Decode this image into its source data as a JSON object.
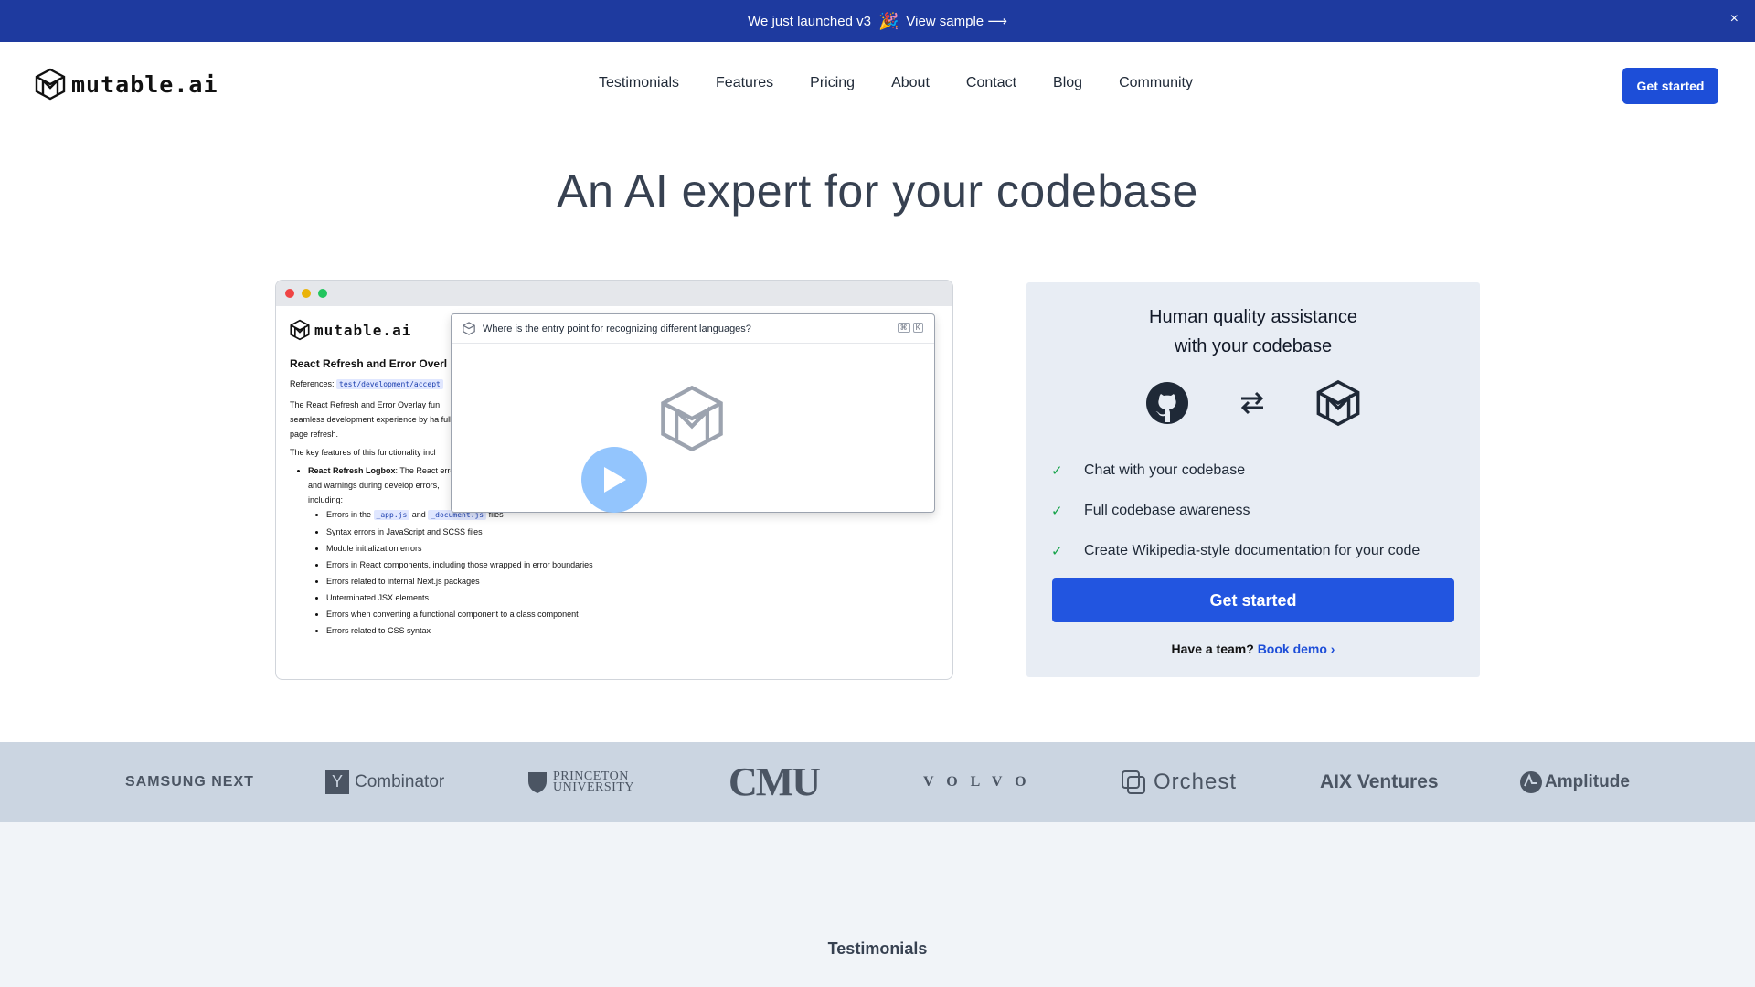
{
  "announcement": {
    "text": "We just launched v3",
    "emoji": "🎉",
    "link": "View sample ⟶",
    "close": "×"
  },
  "header": {
    "brand": "mutable.ai",
    "nav": [
      "Testimonials",
      "Features",
      "Pricing",
      "About",
      "Contact",
      "Blog",
      "Community"
    ],
    "cta": "Get started"
  },
  "hero": {
    "title": "An AI expert for your codebase"
  },
  "demo": {
    "brand": "mutable.ai",
    "doc_title": "React Refresh and Error Overl",
    "refs_label": "References:",
    "refs_code": "test/development/accept",
    "para1": "The React Refresh and Error Overlay fun seamless development experience by ha full page refresh.",
    "para2": "The key features of this functionality incl",
    "bullet_title": "React Refresh Logbox",
    "bullet_text": ": The React errors and warnings during develop errors, including:",
    "sub_items": [
      "Syntax errors in JavaScript and SCSS files",
      "Module initialization errors",
      "Errors in React components, including those wrapped in error boundaries",
      "Errors related to internal Next.js packages",
      "Unterminated JSX elements",
      "Errors when converting a functional component to a class component",
      "Errors related to CSS syntax"
    ],
    "first_item_pre": "Errors in the",
    "first_item_code1": "_app.js",
    "first_item_mid": "and",
    "first_item_code2": "_document.js",
    "first_item_post": "files",
    "popup_question": "Where is the entry point for recognizing different languages?",
    "popup_keys": [
      "⌘",
      "K"
    ]
  },
  "card": {
    "title_line1": "Human quality assistance",
    "title_line2": "with your codebase",
    "features": [
      "Chat with your codebase",
      "Full codebase awareness",
      "Create Wikipedia-style documentation for your code"
    ],
    "cta": "Get started",
    "team_text": "Have a team?",
    "team_link": "Book demo ›"
  },
  "logos": {
    "samsung": "SAMSUNG NEXT",
    "yc_box": "Y",
    "yc": "Combinator",
    "princeton1": "PRINCETON",
    "princeton2": "UNIVERSITY",
    "cmu": "CMU",
    "volvo": "VOLVO",
    "orchest": "Orchest",
    "aix": "AIX Ventures",
    "amplitude": "Amplitude"
  },
  "testimonials": {
    "label": "Testimonials"
  },
  "colors": {
    "announce_bg": "#1e3a9f",
    "primary": "#1d4ed8",
    "card_bg": "#e8edf4",
    "logo_strip": "#cbd5e1",
    "check": "#16a34a"
  }
}
